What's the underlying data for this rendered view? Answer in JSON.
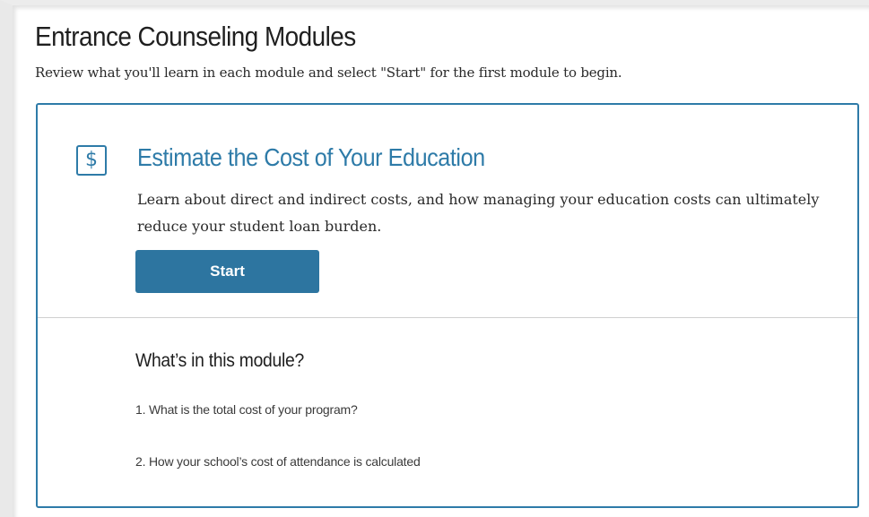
{
  "page": {
    "title": "Entrance Counseling Modules",
    "subtitle": "Review what you'll learn in each module and select \"Start\" for the first module to begin."
  },
  "module": {
    "icon": "dollar-icon",
    "icon_glyph": "$",
    "title": "Estimate the Cost of Your Education",
    "description": "Learn about direct and indirect costs, and how managing your education costs can ultimately reduce your student loan burden.",
    "start_label": "Start",
    "contents_heading": "What’s in this module?",
    "contents": [
      "1. What is the total cost of your program?",
      "2. How your school’s cost of attendance is calculated"
    ]
  },
  "colors": {
    "accent": "#2e7ba8",
    "button": "#2d75a0",
    "text": "#1f1f1f",
    "divider": "#cfcfcf"
  }
}
